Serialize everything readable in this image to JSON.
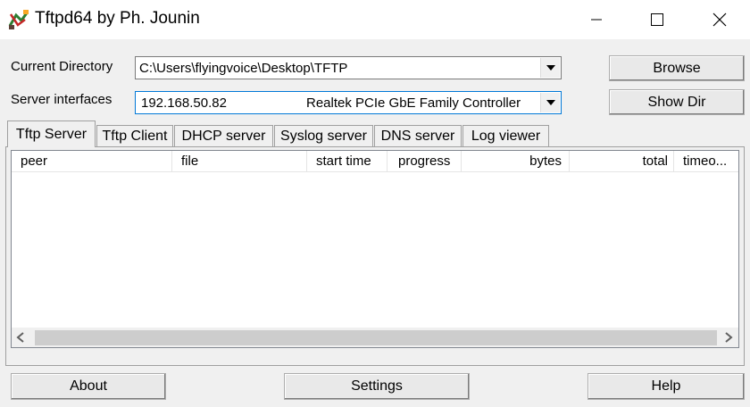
{
  "window": {
    "title": "Tftpd64 by Ph. Jounin",
    "icon": "tftpd-app-icon",
    "controls": [
      "minimize-icon",
      "maximize-icon",
      "close-icon"
    ]
  },
  "settings": {
    "current_directory_label": "Current Directory",
    "current_directory_value": "C:\\Users\\flyingvoice\\Desktop\\TFTP",
    "server_interfaces_label": "Server interfaces",
    "server_interface_ip": "192.168.50.82",
    "server_interface_adapter": "Realtek PCIe GbE Family Controller",
    "browse_label": "Browse",
    "show_dir_label": "Show Dir"
  },
  "tabs": [
    {
      "label": "Tftp Server",
      "active": true
    },
    {
      "label": "Tftp Client",
      "active": false
    },
    {
      "label": "DHCP server",
      "active": false
    },
    {
      "label": "Syslog server",
      "active": false
    },
    {
      "label": "DNS server",
      "active": false
    },
    {
      "label": "Log viewer",
      "active": false
    }
  ],
  "table": {
    "columns": [
      "peer",
      "file",
      "start time",
      "progress",
      "bytes",
      "total",
      "timeo..."
    ],
    "rows": []
  },
  "footer": {
    "about_label": "About",
    "settings_label": "Settings",
    "help_label": "Help"
  }
}
